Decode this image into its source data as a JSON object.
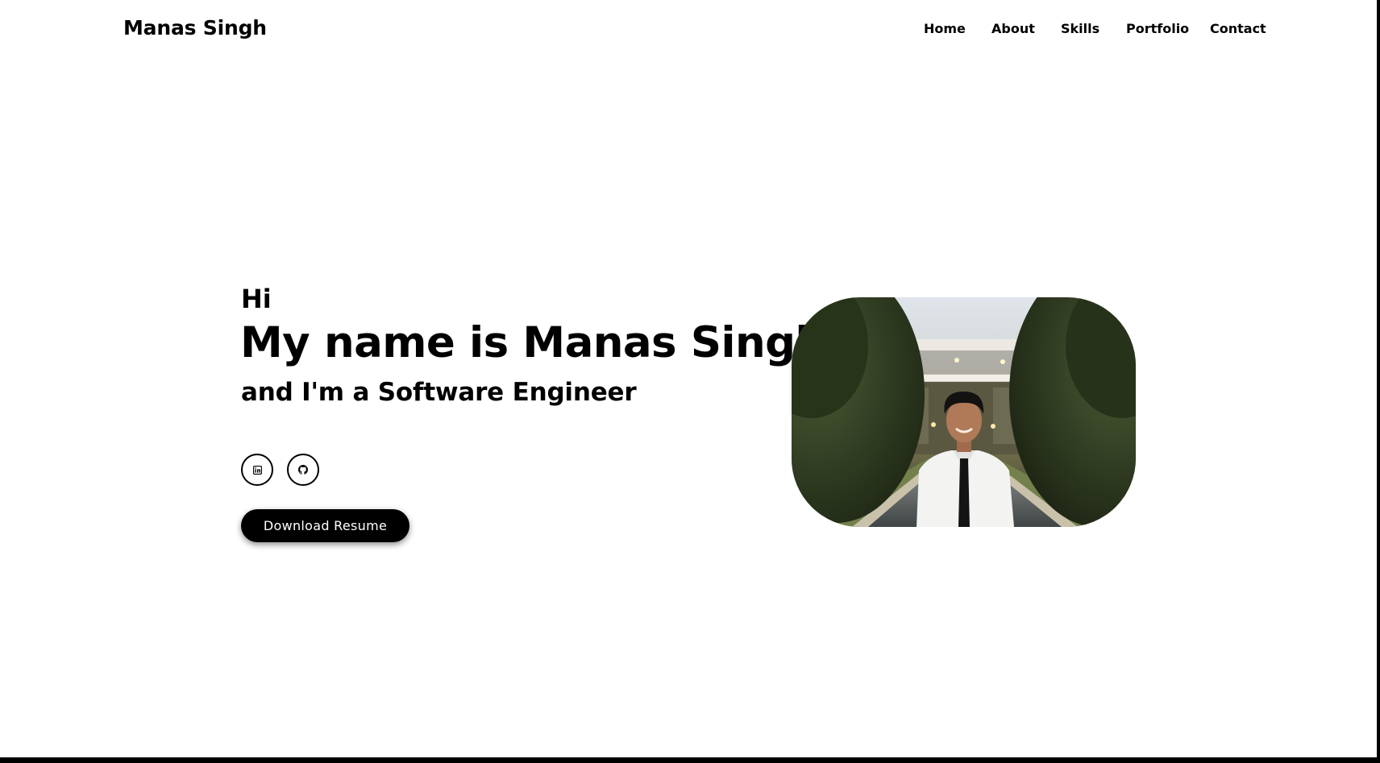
{
  "header": {
    "brand": "Manas Singh",
    "nav": [
      "Home",
      "About",
      "Skills",
      "Portfolio",
      "Contact"
    ]
  },
  "hero": {
    "greeting": "Hi",
    "headline": "My name is Manas Singh",
    "subheadline": "and I'm a Software Engineer",
    "social": [
      {
        "icon": "linkedin-icon"
      },
      {
        "icon": "github-icon"
      }
    ],
    "resume_button": "Download Resume"
  },
  "colors": {
    "background": "#ffffff",
    "text": "#000000",
    "button_bg": "#000000",
    "button_text": "#ffffff"
  }
}
